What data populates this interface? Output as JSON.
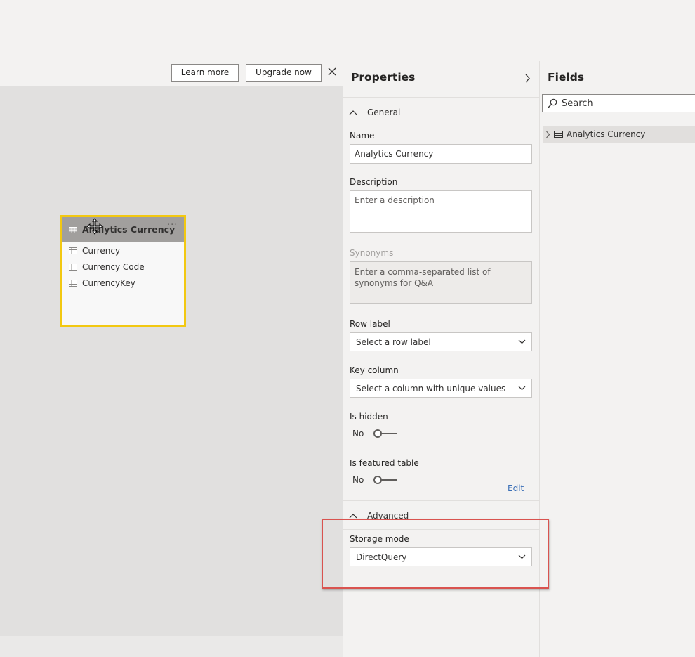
{
  "canvas": {
    "learn_more": "Learn more",
    "upgrade_now": "Upgrade now",
    "table_card": {
      "title": "Analytics Currency",
      "more": "···",
      "columns": [
        "Currency",
        "Currency Code",
        "CurrencyKey"
      ]
    }
  },
  "properties": {
    "title": "Properties",
    "general_label": "General",
    "name_label": "Name",
    "name_value": "Analytics Currency",
    "description_label": "Description",
    "description_placeholder": "Enter a description",
    "synonyms_label": "Synonyms",
    "synonyms_text": "Enter a comma-separated list of synonyms for Q&A",
    "row_label_label": "Row label",
    "row_label_value": "Select a row label",
    "key_column_label": "Key column",
    "key_column_value": "Select a column with unique values",
    "is_hidden_label": "Is hidden",
    "is_hidden_value": "No",
    "is_featured_label": "Is featured table",
    "is_featured_value": "No",
    "edit_link": "Edit",
    "advanced_label": "Advanced",
    "storage_mode_label": "Storage mode",
    "storage_mode_value": "DirectQuery"
  },
  "fields": {
    "title": "Fields",
    "search_placeholder": "Search",
    "tables": [
      {
        "label": "Analytics Currency"
      }
    ]
  },
  "colors": {
    "selection_border": "#f2c811",
    "highlight_box": "#d9534f",
    "link": "#3a6fb7"
  }
}
